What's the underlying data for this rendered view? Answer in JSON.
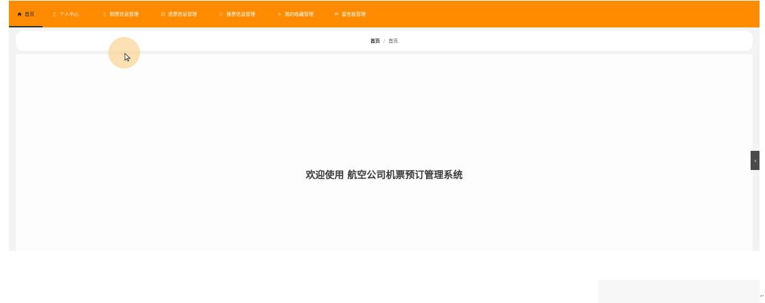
{
  "nav": {
    "items": [
      {
        "label": "首页",
        "icon": "home-icon",
        "active": true
      },
      {
        "label": "个人中心",
        "icon": "user-icon",
        "active": false
      },
      {
        "label": "购票信息管理",
        "icon": "ticket-user-icon",
        "active": false
      },
      {
        "label": "退票信息管理",
        "icon": "grid-icon",
        "active": false
      },
      {
        "label": "换票信息管理",
        "icon": "swap-icon",
        "active": false
      },
      {
        "label": "我的收藏管理",
        "icon": "star-icon",
        "active": false
      },
      {
        "label": "留言板管理",
        "icon": "message-board-icon",
        "active": false
      }
    ]
  },
  "breadcrumb": {
    "first": "首页",
    "separator": "/",
    "current": "首页"
  },
  "main": {
    "welcome": "欢迎使用 航空公司机票预订管理系统"
  },
  "side_handle": {
    "glyph": "‹"
  },
  "corner": {
    "glyph": "↵"
  },
  "colors": {
    "nav_bg": "#ff8c00",
    "content_bg": "#f3f3f3",
    "text": "#3a3a3a"
  }
}
